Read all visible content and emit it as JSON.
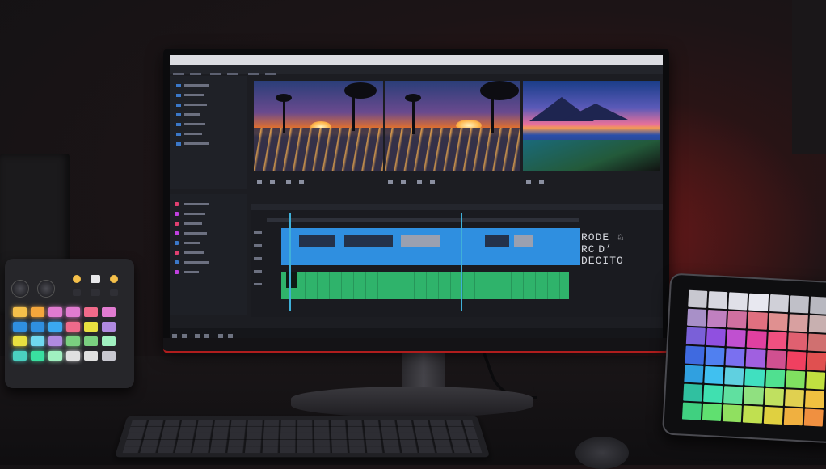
{
  "scene": {
    "type": "video-editing-desk-setup",
    "accent_color": "#b01d1d",
    "timeline_clip_color": "#2f8fe0",
    "audio_track_color": "#2fb36b"
  },
  "editor": {
    "overlay_text": {
      "line1": "RODE",
      "line2": "RC D’",
      "line3": "DECITO",
      "glyph": "♘"
    }
  },
  "controller": {
    "pad_colors": [
      "#f5c04a",
      "#f5a73c",
      "#e07bd0",
      "#e07bd0",
      "#2f8fe0",
      "#2f8fe0",
      "#3aa8f0",
      "#f06a8a",
      "#e8e040",
      "#6fd9f0",
      "#b08ae0",
      "#7ad080",
      "#4ad0c0",
      "#39e0a0",
      "#a0f0c0",
      "#e0e0e0"
    ]
  },
  "tablet": {
    "swatches": [
      "#c8c8d0",
      "#d8d8e0",
      "#e0e0e8",
      "#e8e8f0",
      "#d0d0d8",
      "#c0c0c8",
      "#b8b8c0",
      "#a890c8",
      "#c080c0",
      "#d070a0",
      "#e07080",
      "#e09090",
      "#d8a0a0",
      "#c8b0b0",
      "#7a60d8",
      "#9050e0",
      "#c050d0",
      "#e040a0",
      "#f05080",
      "#e06070",
      "#d07070",
      "#3f6ae0",
      "#5080f0",
      "#7a70f0",
      "#a060e0",
      "#d05090",
      "#f04060",
      "#e05050",
      "#30a0e0",
      "#40c0f0",
      "#60d0e0",
      "#40e0c0",
      "#50e090",
      "#80e060",
      "#c0e040",
      "#30c0a0",
      "#40e0b0",
      "#60e0a0",
      "#90e080",
      "#c0e060",
      "#e0d050",
      "#f0c040",
      "#40d080",
      "#60e070",
      "#90e060",
      "#c0e050",
      "#e0d040",
      "#f0b040",
      "#f09040"
    ]
  }
}
